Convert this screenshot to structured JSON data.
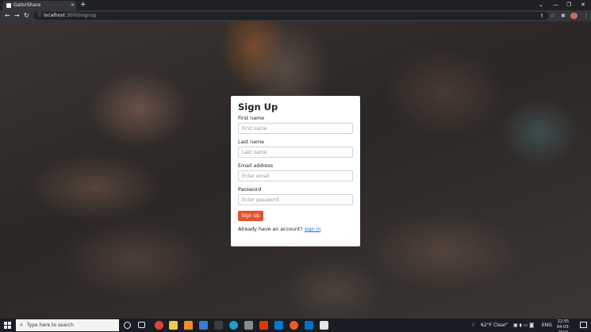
{
  "browser": {
    "tab_title": "GatorShare",
    "tab_close": "✕",
    "new_tab": "+",
    "url_host": "localhost",
    "url_path": ":3000/signup",
    "back": "←",
    "forward": "→",
    "reload": "↻",
    "info": "ⓘ",
    "share_icon": "⇪",
    "star_icon": "☆",
    "extensions_icon": "✱",
    "menu_icon": "⋮",
    "window_controls": {
      "dropdown": "⌄",
      "minimize": "—",
      "maximize": "❐",
      "close": "✕"
    }
  },
  "form": {
    "title": "Sign Up",
    "first_name_label": "First name",
    "first_name_placeholder": "First name",
    "last_name_label": "Last name",
    "last_name_placeholder": "Last name",
    "email_label": "Email address",
    "email_placeholder": "Enter email",
    "password_label": "Password",
    "password_placeholder": "Enter password",
    "submit_label": "Sign Up",
    "signin_prompt": "Already have an account?",
    "signin_link": "sign in",
    "accent_color": "#e2542e",
    "link_color": "#0d6efd"
  },
  "taskbar": {
    "search_placeholder": "Type here to search",
    "search_icon": "⌕",
    "weather_icon": "☾",
    "weather": "62°F  Clear",
    "language": "ENG",
    "time": "22:55",
    "date": "04-03-2022",
    "apps": [
      "cortana-icon",
      "task-view-icon",
      "chrome-icon",
      "file-explorer-icon",
      "vlc-icon",
      "store-icon",
      "nvidia-icon",
      "edge-icon",
      "office-icon",
      "terminal-icon",
      "vscode-icon",
      "postman-icon",
      "outlook-icon",
      "cypress-icon"
    ]
  }
}
